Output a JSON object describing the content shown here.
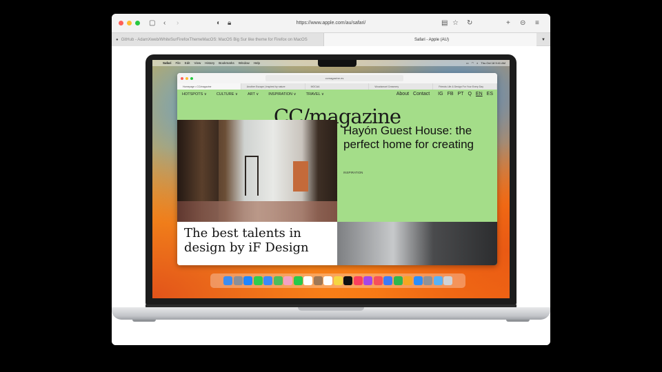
{
  "browser": {
    "url": "https://www.apple.com/au/safari/",
    "tabs": [
      {
        "label": "GitHub - AdamXweb/WhiteSurFirefoxThemeMacOS: MacOS Big Sur like theme for Firefox on MacOS",
        "active": false
      },
      {
        "label": "Safari - Apple (AU)",
        "active": true
      }
    ],
    "tab_menu_icon": "chevron-down-icon"
  },
  "mac": {
    "menu": [
      "Safari",
      "File",
      "Edit",
      "View",
      "History",
      "Bookmarks",
      "Window",
      "Help"
    ],
    "clock": "Thu Oct 18  9:41 AM"
  },
  "inner_browser": {
    "url": "ccmagazine.es",
    "tabs": [
      "Homepage • CC/magazine",
      "Another Escape | Inspired by nature",
      "MOCAA",
      "Woodsmoel Creamery",
      "Friends Life & Design For Your Every Day"
    ]
  },
  "site": {
    "nav": [
      "HOTSPOTS ∨",
      "CULTURE ∨",
      "ART ∨",
      "INSPIRATION ∨",
      "TRAVEL ∨"
    ],
    "nav_right": [
      "About",
      "Contact"
    ],
    "social": [
      "IG",
      "FB",
      "PT"
    ],
    "languages": [
      "EN",
      "ES"
    ],
    "search_icon": "Q",
    "logo": "CC/magazine",
    "headline": "Hayón Guest House: the perfect home for creating",
    "category": "INSPIRATION",
    "card_title": "The best talents in design by iF Design"
  },
  "colors": {
    "site_bg": "#a4dd89"
  }
}
